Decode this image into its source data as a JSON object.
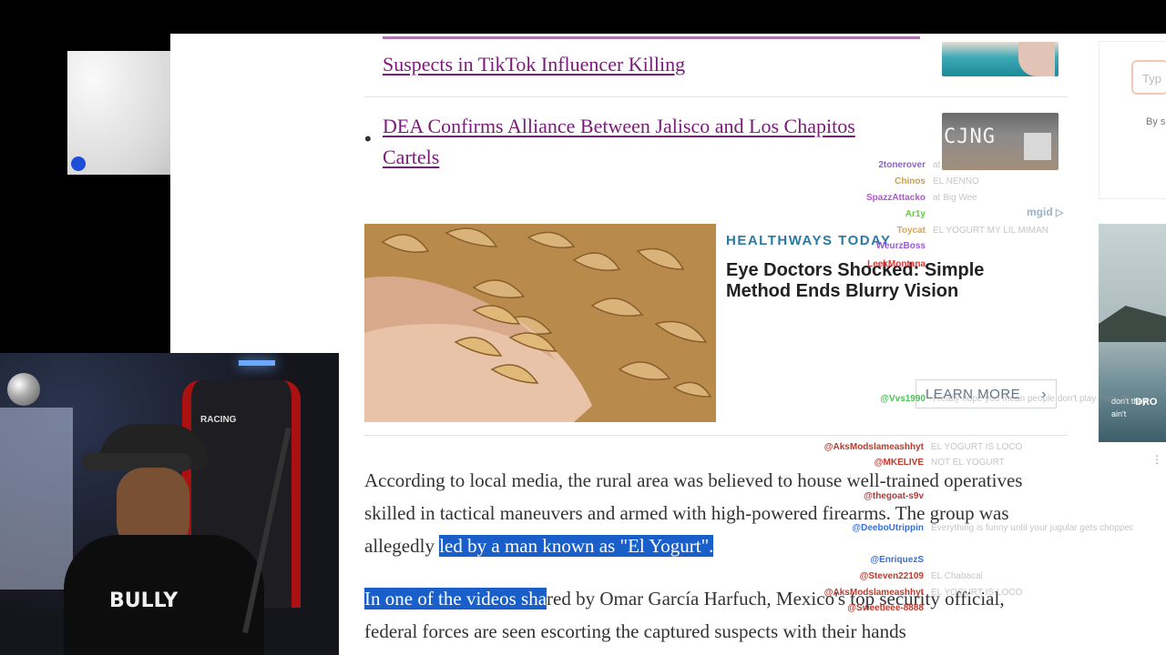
{
  "article": {
    "prev_headline": "Suspects in TikTok Influencer Killing",
    "headline": "DEA Confirms Alliance Between Jalisco and Los Chapitos Cartels",
    "thumb2_text": "CJNG",
    "paragraph1": {
      "plain": "According to local media, the rural area was believed to house well-trained operatives skilled in tactical maneuvers and armed with high-powered firearms. The group was allegedly ",
      "highlighted": "led by a man known as \"El Yogurt\"."
    },
    "paragraph2": {
      "highlighted": "In one of the videos sha",
      "plain": "red by Omar García Harfuch, Mexico's top security official, federal forces are seen escorting the captured suspects with their hands"
    }
  },
  "ad": {
    "network": "mgid",
    "brand": "HEALTHWAYS TODAY",
    "title": "Eye Doctors Shocked: Simple Method Ends Blurry Vision",
    "cta": "LEARN MORE",
    "cta_icon": "chevron-right-icon"
  },
  "sidebar": {
    "search_placeholder": "Typ",
    "by_text": "By s",
    "video_overlay": "DRO",
    "video_caption": "don't they ain't"
  },
  "chat": [
    {
      "user": "2tonerover",
      "msg": "at bebe",
      "color": "#8a63d2"
    },
    {
      "user": "Chinos",
      "msg": "EL NENNO",
      "color": "#c8a04a"
    },
    {
      "user": "SpazzAttacko",
      "msg": "at Big Wee",
      "color": "#b455d6"
    },
    {
      "user": "Ar1y",
      "msg": "",
      "color": "#5fcf3a"
    },
    {
      "user": "Toycat",
      "msg": "EL YOGURT MY LIL MIMAN",
      "color": "#d8a94b"
    },
    {
      "user": "WeurzBoss",
      "msg": "",
      "color": "#9b59d6"
    },
    {
      "user": "LeekMontana",
      "msg": "",
      "color": "#d63a3a"
    },
    {
      "user": "@Vvs1990",
      "msg": "I really hope you mean people don't play They Big things and you saying the sh",
      "color": "#4dc25a"
    },
    {
      "user": "@AksModslameashhyt",
      "msg": "EL YOGURT IS LOCO",
      "color": "#c0392b"
    },
    {
      "user": "@MKELIVE",
      "msg": "NOT EL YOGURT",
      "color": "#c0392b"
    },
    {
      "user": "@thegoat-s9v",
      "msg": "",
      "color": "#b13a3a"
    },
    {
      "user": "@DeeboUtrippin",
      "msg": "Everything is funny until your jugular gets chopped",
      "color": "#3a6fd6"
    },
    {
      "user": "@EnriquezS",
      "msg": "",
      "color": "#3a6fd6"
    },
    {
      "user": "@Steven22109",
      "msg": "EL Chabacal",
      "color": "#c0392b"
    },
    {
      "user": "@AksModslameashhyt",
      "msg": "EL YOGURT IS LOCO",
      "color": "#c0392b"
    },
    {
      "user": "@Sweetleee-8888",
      "msg": "",
      "color": "#c0392b"
    }
  ]
}
